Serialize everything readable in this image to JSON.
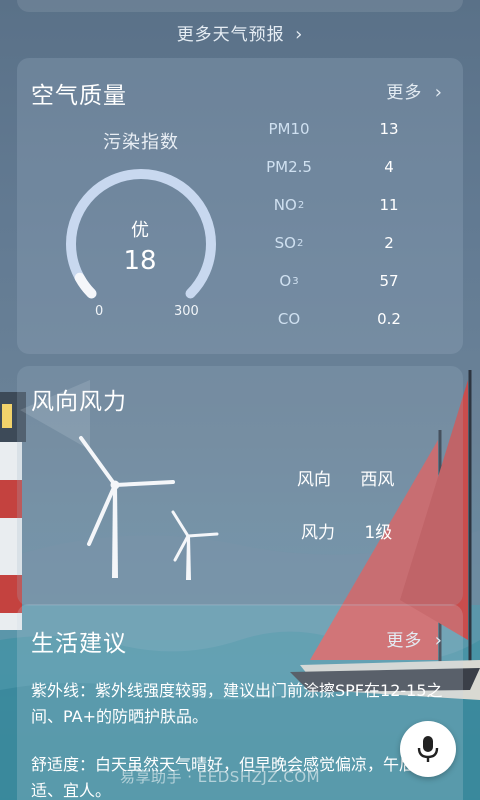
{
  "more_forecast": {
    "label": "更多天气预报"
  },
  "air_quality": {
    "title": "空气质量",
    "more_label": "更多",
    "index_label": "污染指数",
    "level": "优",
    "value": "18",
    "gauge_min": "0",
    "gauge_max": "300",
    "gauge_fraction": 0.06,
    "pollutants": [
      {
        "name": "PM10",
        "value": "13"
      },
      {
        "name": "PM2.5",
        "value": "4"
      },
      {
        "name": "NO",
        "sub": "2",
        "value": "11"
      },
      {
        "name": "SO",
        "sub": "2",
        "value": "2"
      },
      {
        "name": "O",
        "sub": "3",
        "value": "57"
      },
      {
        "name": "CO",
        "value": "0.2"
      }
    ]
  },
  "wind": {
    "title": "风向风力",
    "direction_label": "风向",
    "direction_value": "西风",
    "force_label": "风力",
    "force_value": "1级"
  },
  "life": {
    "title": "生活建议",
    "more_label": "更多",
    "uv": "紫外线：紫外线强度较弱，建议出门前涂擦SPF在12-15之间、PA+的防晒护肤品。",
    "comfort": "舒适度：白天虽然天气晴好，但早晚会感觉偏凉，午后舒适、宜人。"
  },
  "watermark": "易享助手 · EEDSHZJZ.COM",
  "icons": [
    "chevron-right-icon",
    "mic-icon",
    "wind-turbine-icon",
    "lighthouse-icon",
    "sailboat-icon"
  ],
  "colors": {
    "gauge_track": "#c8d8ef",
    "gauge_fill": "#f4f6fa",
    "sail": "#d45a5a",
    "lighthouse_red": "#c4423f"
  }
}
